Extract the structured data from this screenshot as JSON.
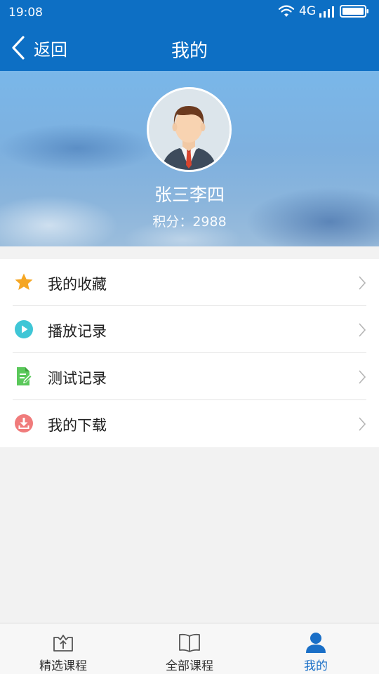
{
  "status_bar": {
    "time": "19:08",
    "network": "4G"
  },
  "nav": {
    "back_label": "返回",
    "title": "我的"
  },
  "profile": {
    "name": "张三李四",
    "score": "积分：2988"
  },
  "menu": {
    "items": [
      {
        "label": "我的收藏",
        "icon": "star-icon",
        "color": "#f5a623"
      },
      {
        "label": "播放记录",
        "icon": "play-icon",
        "color": "#3fc6d6"
      },
      {
        "label": "测试记录",
        "icon": "document-edit-icon",
        "color": "#5ac85a"
      },
      {
        "label": "我的下载",
        "icon": "download-icon",
        "color": "#f07b7b"
      }
    ]
  },
  "tabbar": {
    "tabs": [
      {
        "label": "精选课程",
        "icon": "featured-courses-icon",
        "active": false
      },
      {
        "label": "全部课程",
        "icon": "book-icon",
        "active": false
      },
      {
        "label": "我的",
        "icon": "user-icon",
        "active": true
      }
    ]
  },
  "colors": {
    "primary": "#0d6fc4",
    "active_tab": "#1a6fc7",
    "background": "#f2f2f2"
  }
}
